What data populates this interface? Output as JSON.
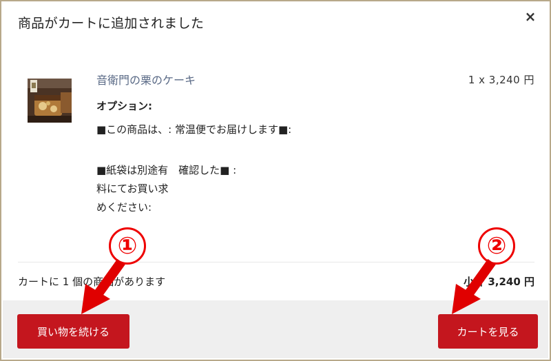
{
  "modal": {
    "title": "商品がカートに追加されました",
    "close_label": "×"
  },
  "item": {
    "name": "音衛門の栗のケーキ",
    "price_line": "1 x 3,240 円",
    "options_title": "オプション:",
    "option_lines": [
      "■この商品は、: 常温便でお届けします■:",
      "■紙袋は別途有　確認した■ :",
      "料にてお買い求",
      "めください:"
    ]
  },
  "summary": {
    "count_text": "カートに 1 個の商品があります",
    "subtotal_text": "小計 3,240 円"
  },
  "buttons": {
    "continue_label": "買い物を続ける",
    "view_cart_label": "カートを見る"
  },
  "annotations": {
    "marker_1": "①",
    "marker_2": "②"
  },
  "colors": {
    "button": "#c4161e",
    "annotation": "#e00000",
    "frame": "#b8a88a",
    "product_link": "#5a6a86"
  }
}
